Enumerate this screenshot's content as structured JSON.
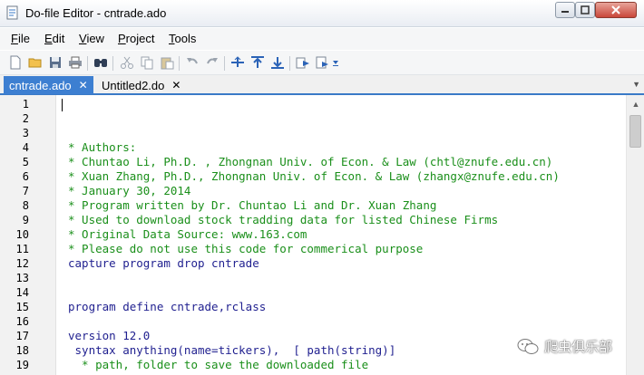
{
  "window": {
    "title": "Do-file Editor - cntrade.ado"
  },
  "menu": {
    "items": [
      "File",
      "Edit",
      "View",
      "Project",
      "Tools"
    ],
    "mnemonics": [
      "F",
      "E",
      "V",
      "P",
      "T"
    ]
  },
  "toolbar": {
    "icons": [
      "new-file-icon",
      "open-folder-icon",
      "save-icon",
      "print-icon",
      "find-icon",
      "cut-icon",
      "copy-icon",
      "paste-icon",
      "undo-icon",
      "redo-icon",
      "indent-icon",
      "shift-up-icon",
      "shift-down-icon",
      "run-icon",
      "execute-icon",
      "toolbar-dropdown-icon"
    ]
  },
  "tabs": [
    {
      "label": "cntrade.ado",
      "close": "✕",
      "active": true
    },
    {
      "label": "Untitled2.do",
      "close": "✕",
      "active": false
    }
  ],
  "editor": {
    "lines": [
      {
        "n": "1",
        "text": "",
        "kind": "plain"
      },
      {
        "n": "2",
        "text": "",
        "kind": "plain"
      },
      {
        "n": "3",
        "text": "",
        "kind": "plain"
      },
      {
        "n": "4",
        "text": "* Authors:",
        "kind": "comment"
      },
      {
        "n": "5",
        "text": "* Chuntao Li, Ph.D. , Zhongnan Univ. of Econ. & Law (chtl@znufe.edu.cn)",
        "kind": "comment"
      },
      {
        "n": "6",
        "text": "* Xuan Zhang, Ph.D., Zhongnan Univ. of Econ. & Law (zhangx@znufe.edu.cn)",
        "kind": "comment"
      },
      {
        "n": "7",
        "text": "* January 30, 2014",
        "kind": "comment"
      },
      {
        "n": "8",
        "text": "* Program written by Dr. Chuntao Li and Dr. Xuan Zhang",
        "kind": "comment"
      },
      {
        "n": "9",
        "text": "* Used to download stock tradding data for listed Chinese Firms",
        "kind": "comment"
      },
      {
        "n": "10",
        "text": "* Original Data Source: www.163.com",
        "kind": "comment"
      },
      {
        "n": "11",
        "text": "* Please do not use this code for commerical purpose",
        "kind": "comment"
      },
      {
        "n": "12",
        "text": "capture program drop cntrade",
        "kind": "kw"
      },
      {
        "n": "13",
        "text": "",
        "kind": "plain"
      },
      {
        "n": "14",
        "text": "",
        "kind": "plain"
      },
      {
        "n": "15",
        "text": "program define cntrade,rclass",
        "kind": "kw"
      },
      {
        "n": "16",
        "text": "",
        "kind": "plain"
      },
      {
        "n": "17",
        "text": "version 12.0",
        "kind": "kw"
      },
      {
        "n": "18",
        "text": " syntax anything(name=tickers),  [ path(string)]",
        "kind": "kw"
      },
      {
        "n": "19",
        "text": "  * path, folder to save the downloaded file",
        "kind": "comment"
      }
    ]
  },
  "watermark": {
    "text": "爬虫俱乐部"
  }
}
